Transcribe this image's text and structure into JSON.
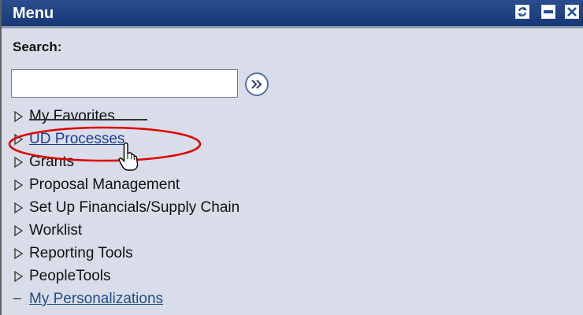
{
  "window": {
    "title": "Menu",
    "buttons": [
      {
        "name": "refresh-icon",
        "color": "#1f4f9d"
      },
      {
        "name": "minimize-icon",
        "color": "#1f4f9d"
      },
      {
        "name": "close-icon",
        "color": "#1f4f9d"
      }
    ]
  },
  "search": {
    "label": "Search:",
    "value": "",
    "placeholder": "",
    "go_icon": "double-chevron-right-icon"
  },
  "menu": {
    "items": [
      {
        "label": "My Favorites",
        "kind": "folder"
      },
      {
        "label": "UD Processes",
        "kind": "link"
      },
      {
        "label": "Grants",
        "kind": "folder"
      },
      {
        "label": "Proposal Management",
        "kind": "folder"
      },
      {
        "label": "Set Up Financials/Supply Chain",
        "kind": "folder"
      },
      {
        "label": "Worklist",
        "kind": "folder"
      },
      {
        "label": "Reporting Tools",
        "kind": "folder"
      },
      {
        "label": "PeopleTools",
        "kind": "folder"
      },
      {
        "label": "My Personalizations",
        "kind": "leaf"
      }
    ]
  },
  "colors": {
    "title_bar": "#1b3f82",
    "panel": "#d8dde9",
    "annotation": "#e00000",
    "link": "#1d3c9a"
  }
}
